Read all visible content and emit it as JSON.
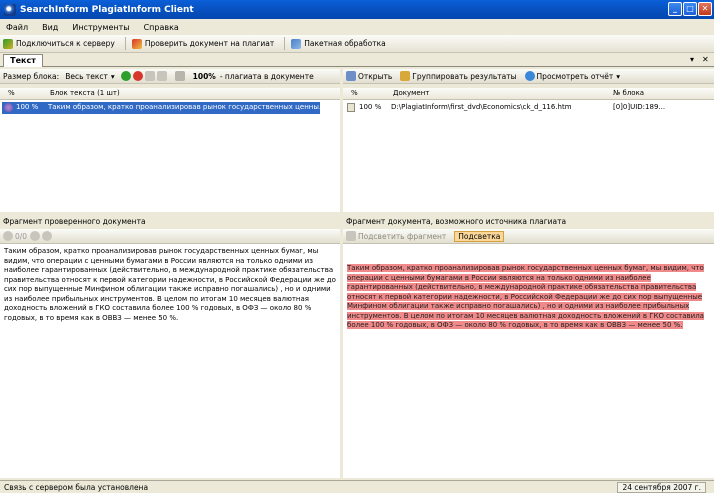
{
  "window": {
    "title": "SearchInform PlagiatInform Client"
  },
  "menu": [
    "Файл",
    "Вид",
    "Инструменты",
    "Справка"
  ],
  "toolbar": {
    "connect_label": "Подключиться к серверу",
    "check_label": "Проверить документ на плагиат",
    "batch_label": "Пакетная обработка"
  },
  "tabs": {
    "text_tab": "Текст"
  },
  "left_panel": {
    "block_size_label": "Размер блока:",
    "block_size_value": "Весь текст",
    "percent_value": "100%",
    "percent_suffix": "- плагиата в документе",
    "col_percent": "%",
    "col_block": "Блок текста (1 шт)",
    "rows": [
      {
        "percent": "100 %",
        "text": "Таким образом, кратко проанализировав рынок государственных ценны..."
      }
    ]
  },
  "right_panel": {
    "open_label": "Открыть",
    "group_label": "Группировать результаты",
    "report_label": "Просмотреть отчёт",
    "col_percent": "%",
    "col_document": "Документ",
    "col_blockno": "№ блока",
    "rows": [
      {
        "percent": "100 %",
        "document": "D:\\PlagiatInform\\first_dvd\\Economics\\ck_d_116.htm",
        "blockno": "[0]0]UID:189..."
      }
    ]
  },
  "fragment_left": {
    "title": "Фрагмент проверенного документа",
    "text": "Таким образом, кратко проанализировав рынок государственных ценных бумаг, мы видим, что операции с ценными бумагами в России являются на только одними из наиболее гарантированных (действительно, в международной практике обязательства правительства относят к первой категории надежности, в Российской Федерации же до сих пор выпущенные Минфином облигации также исправно погашались) , но и одними из наиболее прибыльных инструментов. В целом по итогам 10 месяцев валютная доходность вложений в ГКО составила более 100 % годовых, в ОФЗ — около 80 % годовых, в то время как в ОВВЗ — менее 50 %."
  },
  "fragment_right": {
    "title": "Фрагмент документа, возможного источника плагиата",
    "btn_fragment": "Подсветить фрагмент",
    "btn_highlight": "Подсветка",
    "text": "Таким образом, кратко проанализировав рынок государственных ценных бумаг, мы видим, что операции с ценными бумагами в России являются на только одними из наиболее гарантированных (действительно, в международной практике обязательства правительства относят к первой категории надежности, в Российской Федерации же до сих пор выпущенные Минфином облигации также исправно погашались) , но и одними из наиболее прибыльных инструментов. В целом по итогам 10 месяцев валютная доходность вложений в ГКО составила более 100 % годовых, в ОФЗ — около 80 % годовых, в то время как в ОВВЗ — менее 50 %."
  },
  "status": {
    "message": "Связь с сервером была установлена",
    "date": "24 сентября 2007 г."
  }
}
